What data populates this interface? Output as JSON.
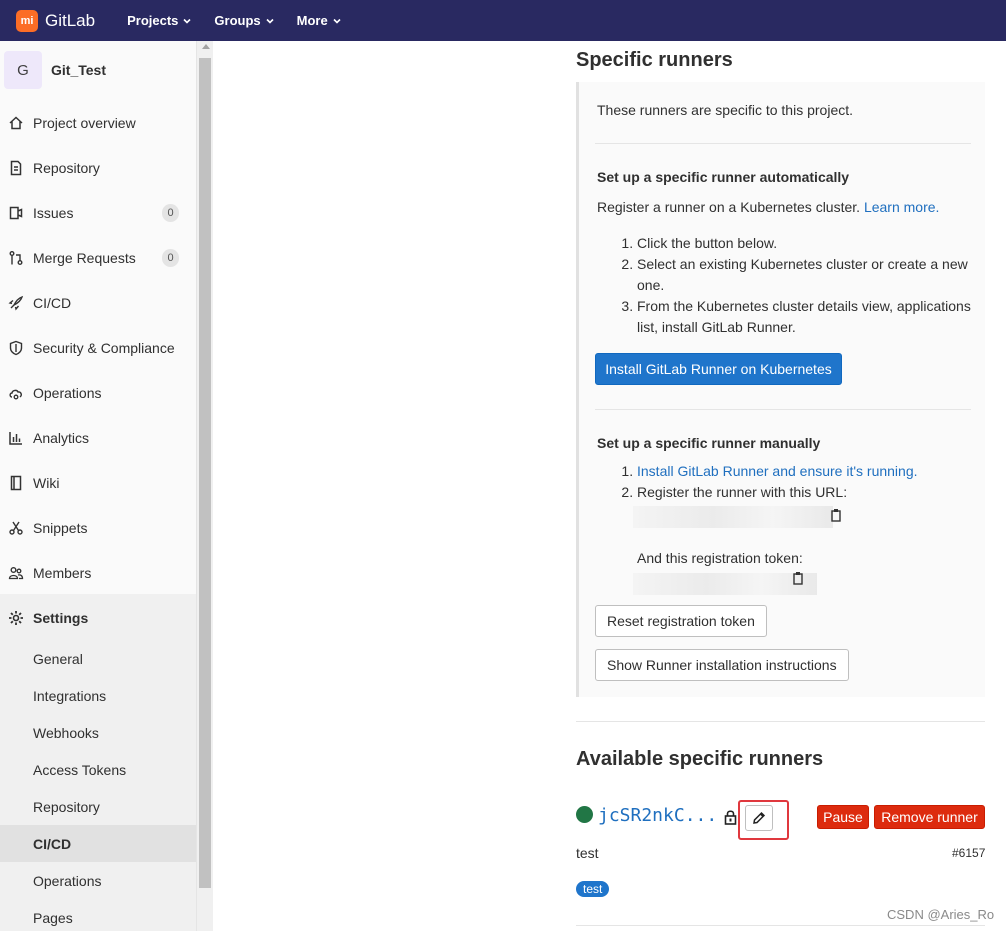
{
  "navbar": {
    "brand": "GitLab",
    "brand_logo_text": "mi",
    "items": [
      {
        "label": "Projects"
      },
      {
        "label": "Groups"
      },
      {
        "label": "More"
      }
    ]
  },
  "sidebar": {
    "project_initial": "G",
    "project_name": "Git_Test",
    "items": [
      {
        "label": "Project overview",
        "icon": "home-icon"
      },
      {
        "label": "Repository",
        "icon": "document-icon"
      },
      {
        "label": "Issues",
        "icon": "issues-icon",
        "count": "0"
      },
      {
        "label": "Merge Requests",
        "icon": "merge-request-icon",
        "count": "0"
      },
      {
        "label": "CI/CD",
        "icon": "rocket-icon"
      },
      {
        "label": "Security & Compliance",
        "icon": "shield-icon"
      },
      {
        "label": "Operations",
        "icon": "cloud-gear-icon"
      },
      {
        "label": "Analytics",
        "icon": "chart-icon"
      },
      {
        "label": "Wiki",
        "icon": "book-icon"
      },
      {
        "label": "Snippets",
        "icon": "scissors-icon"
      },
      {
        "label": "Members",
        "icon": "users-icon"
      },
      {
        "label": "Settings",
        "icon": "gear-icon"
      }
    ],
    "settings_sub": [
      {
        "label": "General"
      },
      {
        "label": "Integrations"
      },
      {
        "label": "Webhooks"
      },
      {
        "label": "Access Tokens"
      },
      {
        "label": "Repository"
      },
      {
        "label": "CI/CD"
      },
      {
        "label": "Operations"
      },
      {
        "label": "Pages"
      }
    ]
  },
  "specific": {
    "title": "Specific runners",
    "intro": "These runners are specific to this project.",
    "auto_heading": "Set up a specific runner automatically",
    "auto_text": "Register a runner on a Kubernetes cluster.",
    "learn_more": "Learn more.",
    "auto_steps": [
      "Click the button below.",
      "Select an existing Kubernetes cluster or create a new one.",
      "From the Kubernetes cluster details view, applications list, install GitLab Runner."
    ],
    "install_button": "Install GitLab Runner on Kubernetes",
    "manual_heading": "Set up a specific runner manually",
    "manual_step1": "Install GitLab Runner and ensure it's running.",
    "manual_step2": "Register the runner with this URL:",
    "token_label": "And this registration token:",
    "reset_button": "Reset registration token",
    "show_button": "Show Runner installation instructions"
  },
  "available": {
    "title": "Available specific runners",
    "runner_id": "jcSR2nkC...",
    "status_color": "#217645",
    "pause_button": "Pause",
    "remove_button": "Remove runner",
    "description": "test",
    "runner_number": "#6157",
    "tag": "test"
  },
  "watermark": "CSDN @Aries_Ro"
}
